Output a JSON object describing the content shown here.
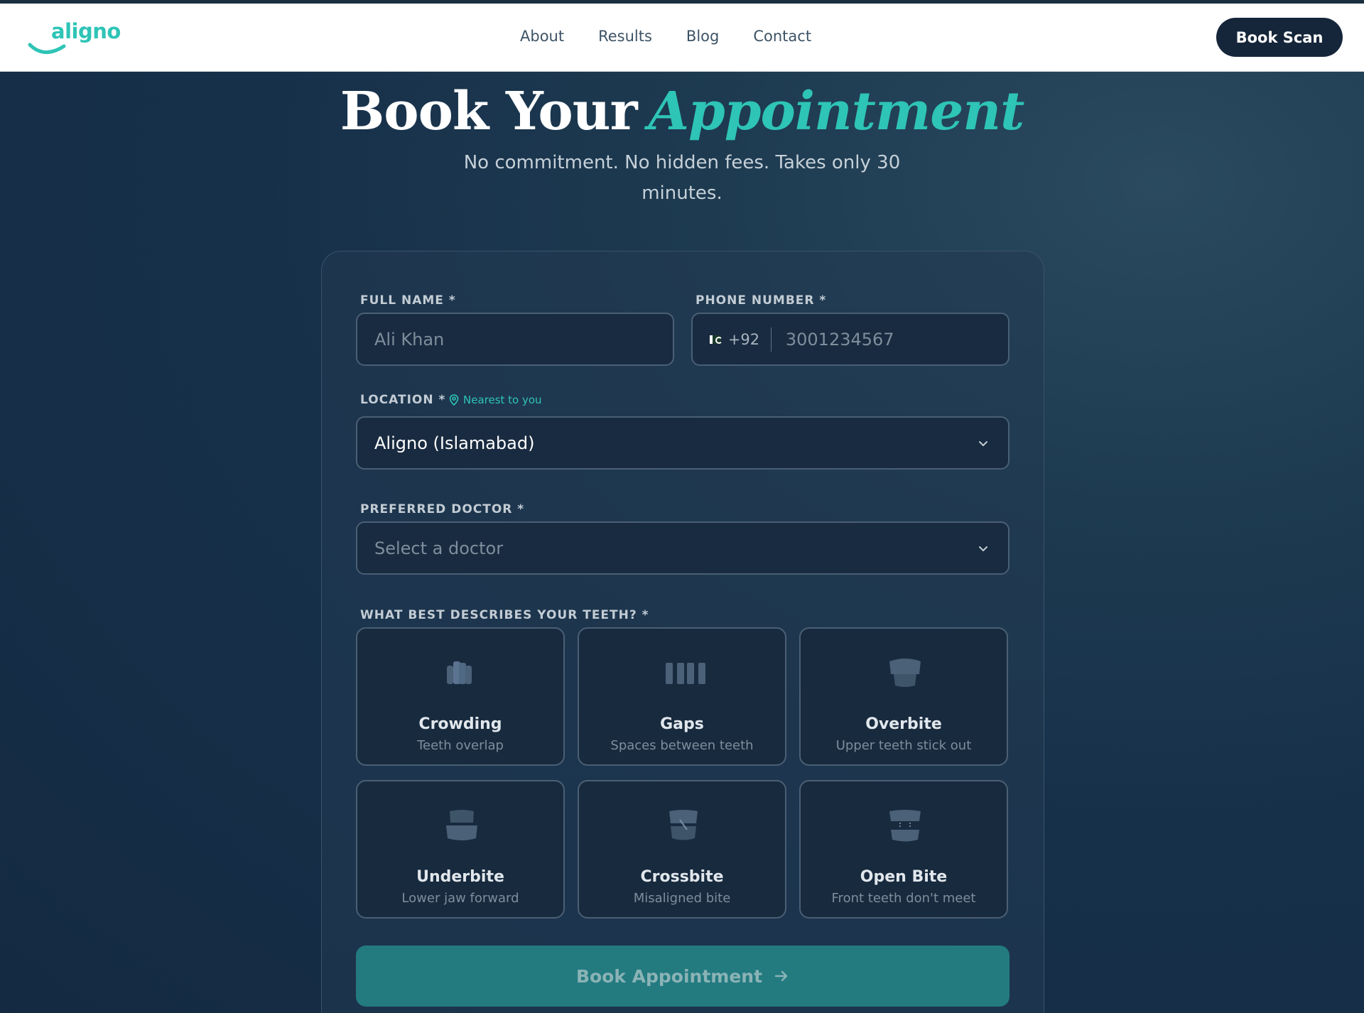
{
  "brand": {
    "logo_text": "aligno"
  },
  "nav": {
    "links": [
      "About",
      "Results",
      "Blog",
      "Contact"
    ],
    "cta": "Book Scan"
  },
  "hero": {
    "title_main": "Book Your",
    "title_accent": "Appointment",
    "subtitle": "No commitment. No hidden fees. Takes only 30 minutes."
  },
  "form": {
    "full_name": {
      "label": "FULL NAME *",
      "placeholder": "Ali Khan",
      "value": ""
    },
    "phone": {
      "label": "PHONE NUMBER *",
      "country_code": "+92",
      "placeholder": "3001234567",
      "value": ""
    },
    "location": {
      "label": "LOCATION *",
      "hint": "Nearest to you",
      "value": "Aligno (Islamabad)"
    },
    "doctor": {
      "label": "PREFERRED DOCTOR *",
      "placeholder": "Select a doctor"
    },
    "teeth": {
      "label": "WHAT BEST DESCRIBES YOUR TEETH? *",
      "options": [
        {
          "title": "Crowding",
          "subtitle": "Teeth overlap",
          "icon": "crowding-teeth-icon"
        },
        {
          "title": "Gaps",
          "subtitle": "Spaces between teeth",
          "icon": "gaps-teeth-icon"
        },
        {
          "title": "Overbite",
          "subtitle": "Upper teeth stick out",
          "icon": "overbite-icon"
        },
        {
          "title": "Underbite",
          "subtitle": "Lower jaw forward",
          "icon": "underbite-icon"
        },
        {
          "title": "Crossbite",
          "subtitle": "Misaligned bite",
          "icon": "crossbite-icon"
        },
        {
          "title": "Open Bite",
          "subtitle": "Front teeth don't meet",
          "icon": "open-bite-icon"
        }
      ]
    },
    "submit_label": "Book Appointment"
  },
  "colors": {
    "accent": "#2ec4b6",
    "nav_cta_bg": "#16263a",
    "submit_bg": "#237b80"
  }
}
